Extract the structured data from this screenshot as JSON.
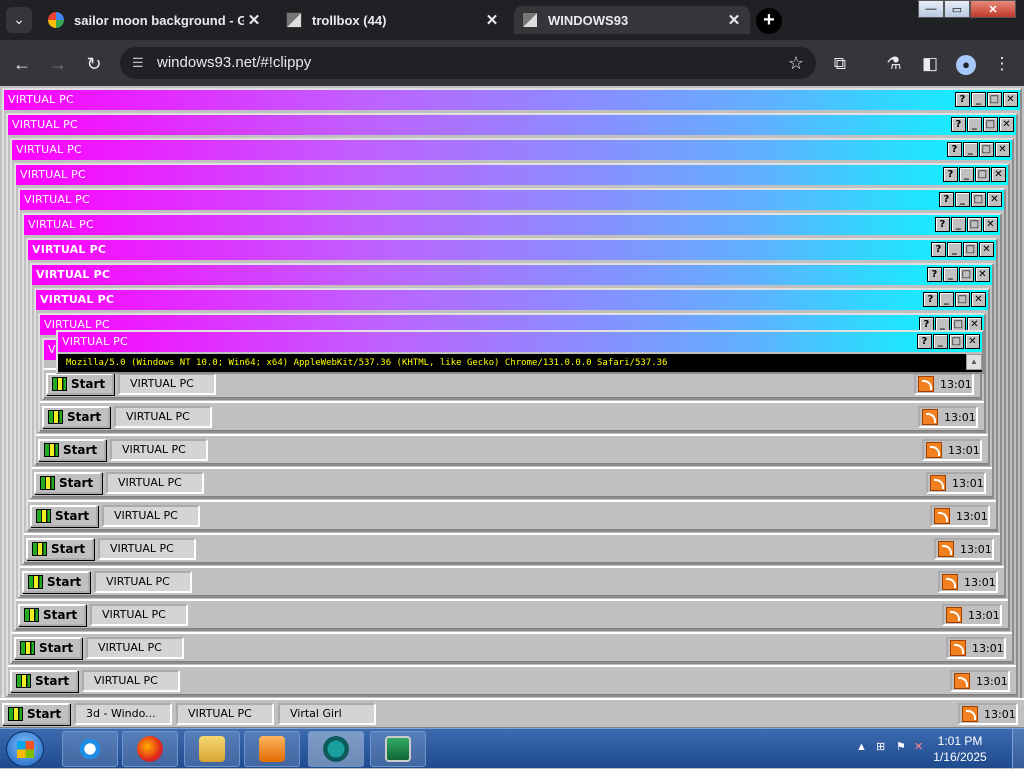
{
  "browser": {
    "tabs": [
      {
        "title": "sailor moon background - Goo",
        "close": "✕"
      },
      {
        "title": "trollbox (44)",
        "close": "✕"
      },
      {
        "title": "WINDOWS93",
        "close": "✕"
      }
    ],
    "new_tab": "+",
    "tab_search": "⌄",
    "url": "windows93.net/#!clippy",
    "window_controls": {
      "minimize": "—",
      "maximize": "▭",
      "close": "✕"
    }
  },
  "page": {
    "window_title": "VIRTUAL PC",
    "title_buttons": {
      "help": "?",
      "minimize": "_",
      "maximize": "□",
      "close": "✕"
    },
    "console_text": "Mozilla/5.0 (Windows NT 10.0; Win64; x64) AppleWebKit/537.36 (KHTML, like Gecko) Chrome/131.0.0.0 Safari/537.36",
    "start_label": "Start",
    "taskbar_button": "VIRTUAL PC",
    "tray_time": "13:01",
    "bottom_taskbar": {
      "start_label": "Start",
      "buttons": [
        "3d - Windo...",
        "VIRTUAL PC",
        "Virtal Girl"
      ],
      "tray_time": "13:01"
    }
  },
  "os": {
    "pinned": [
      "internet-explorer",
      "firefox",
      "file-explorer",
      "media-player",
      "windows93-app",
      "virtual-pc-app"
    ],
    "clock_time": "1:01 PM",
    "clock_date": "1/16/2025"
  }
}
